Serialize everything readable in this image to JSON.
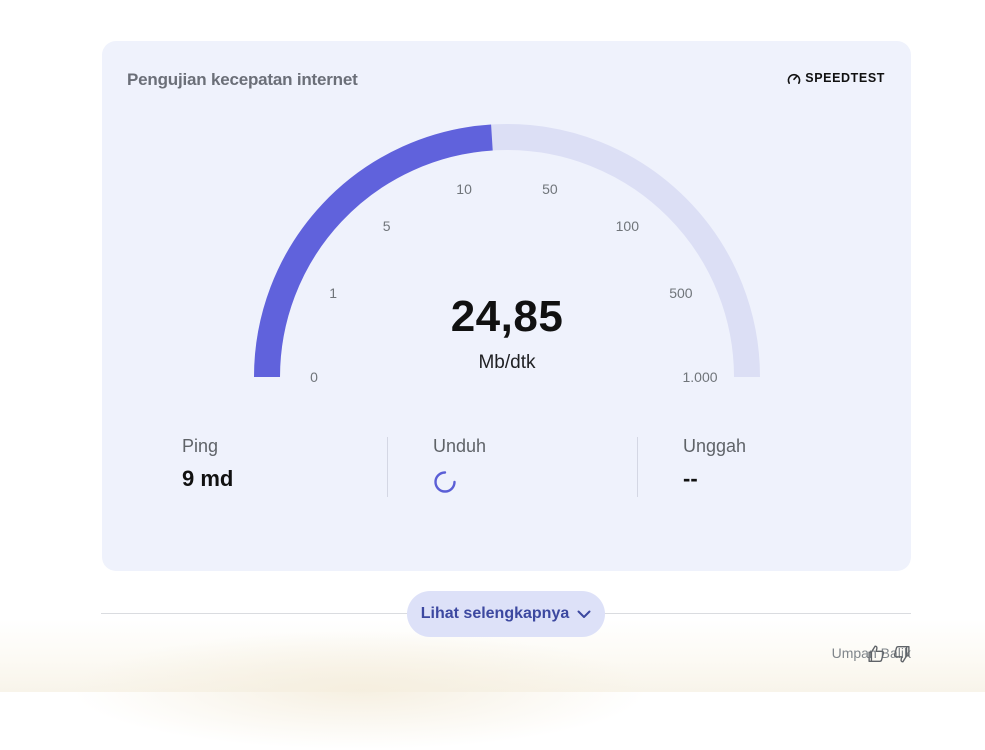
{
  "card": {
    "title": "Pengujian kecepatan internet",
    "brand": "SPEEDTEST"
  },
  "gauge": {
    "value": "24,85",
    "unit": "Mb/dtk",
    "fill_fraction": 0.48,
    "ticks": [
      "0",
      "1",
      "5",
      "10",
      "50",
      "100",
      "500",
      "1.000"
    ],
    "fill_color": "#6062dc",
    "track_color": "#dcdff5"
  },
  "stats": {
    "ping_label": "Ping",
    "ping_value": "9 md",
    "download_label": "Unduh",
    "upload_label": "Unggah",
    "upload_value": "--"
  },
  "more": {
    "label": "Lihat selengkapnya"
  },
  "feedback": {
    "label": "Umpan Balik"
  },
  "icons": {
    "brand": "gauge-icon",
    "spinner": "loading-spinner-icon",
    "chevron": "chevron-down-icon",
    "thumb_up": "thumb-up-icon",
    "thumb_down": "thumb-down-icon"
  }
}
